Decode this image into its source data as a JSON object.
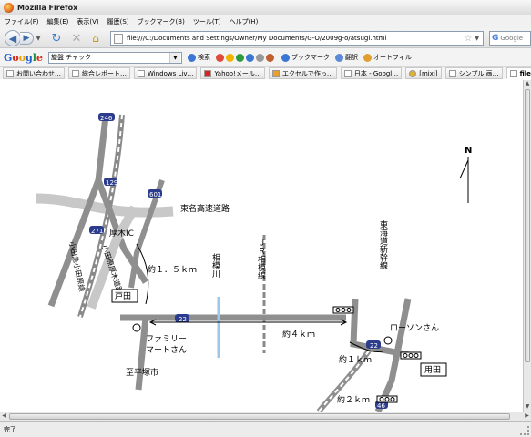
{
  "window": {
    "title": "Mozilla Firefox"
  },
  "menu": [
    "ファイル(F)",
    "編集(E)",
    "表示(V)",
    "履歴(S)",
    "ブックマーク(B)",
    "ツール(T)",
    "ヘルプ(H)"
  ],
  "nav": {
    "url": "file:///C:/Documents and Settings/Owner/My Documents/G-O/2009g-o/atsugi.html",
    "search_placeholder": "Google"
  },
  "google_toolbar": {
    "logo": [
      "G",
      "o",
      "o",
      "g",
      "l",
      "e"
    ],
    "search_value": "旋盤 チャック",
    "tools": [
      "検索",
      "ブックマーク",
      "翻訳",
      "オートフィル"
    ]
  },
  "bookmarks": [
    {
      "label": "お問い合わせ…"
    },
    {
      "label": "総合レポート…"
    },
    {
      "label": "Windows Liv…"
    },
    {
      "label": "Yahoo!メール…"
    },
    {
      "label": "エクセルで作っ…"
    },
    {
      "label": "日本 - Googl…"
    },
    {
      "label": "[mixi]"
    },
    {
      "label": "シンプル 画…"
    },
    {
      "label": "file…tml"
    }
  ],
  "map": {
    "north": "N",
    "expressway": "東名高速道路",
    "odakyu_line": "小田急小田原線",
    "odakyu_road": "小田原厚木道路",
    "atsugi_ic": "厚木IC",
    "dist_1_5": "約１．５ｋｍ",
    "toda_left": "戸田",
    "sagami_river": "相模川",
    "jr_line": "ＪＲ相模線",
    "shinkansen": "東海道新幹線",
    "dist_4": "約４ｋｍ",
    "familymart": [
      "ファミリー",
      "マートさん"
    ],
    "to_hiratsuka": "至平塚市",
    "lawson": "ローソンさん",
    "dist_1": "約１ｋｍ",
    "toda_right": "用田",
    "dist_2": "約２ｋｍ",
    "shields": {
      "r246": "246",
      "r129": "129",
      "r601": "601",
      "r271": "271",
      "r22a": "22",
      "r22b": "22",
      "r46": "46"
    }
  },
  "status": {
    "text": "完了"
  }
}
